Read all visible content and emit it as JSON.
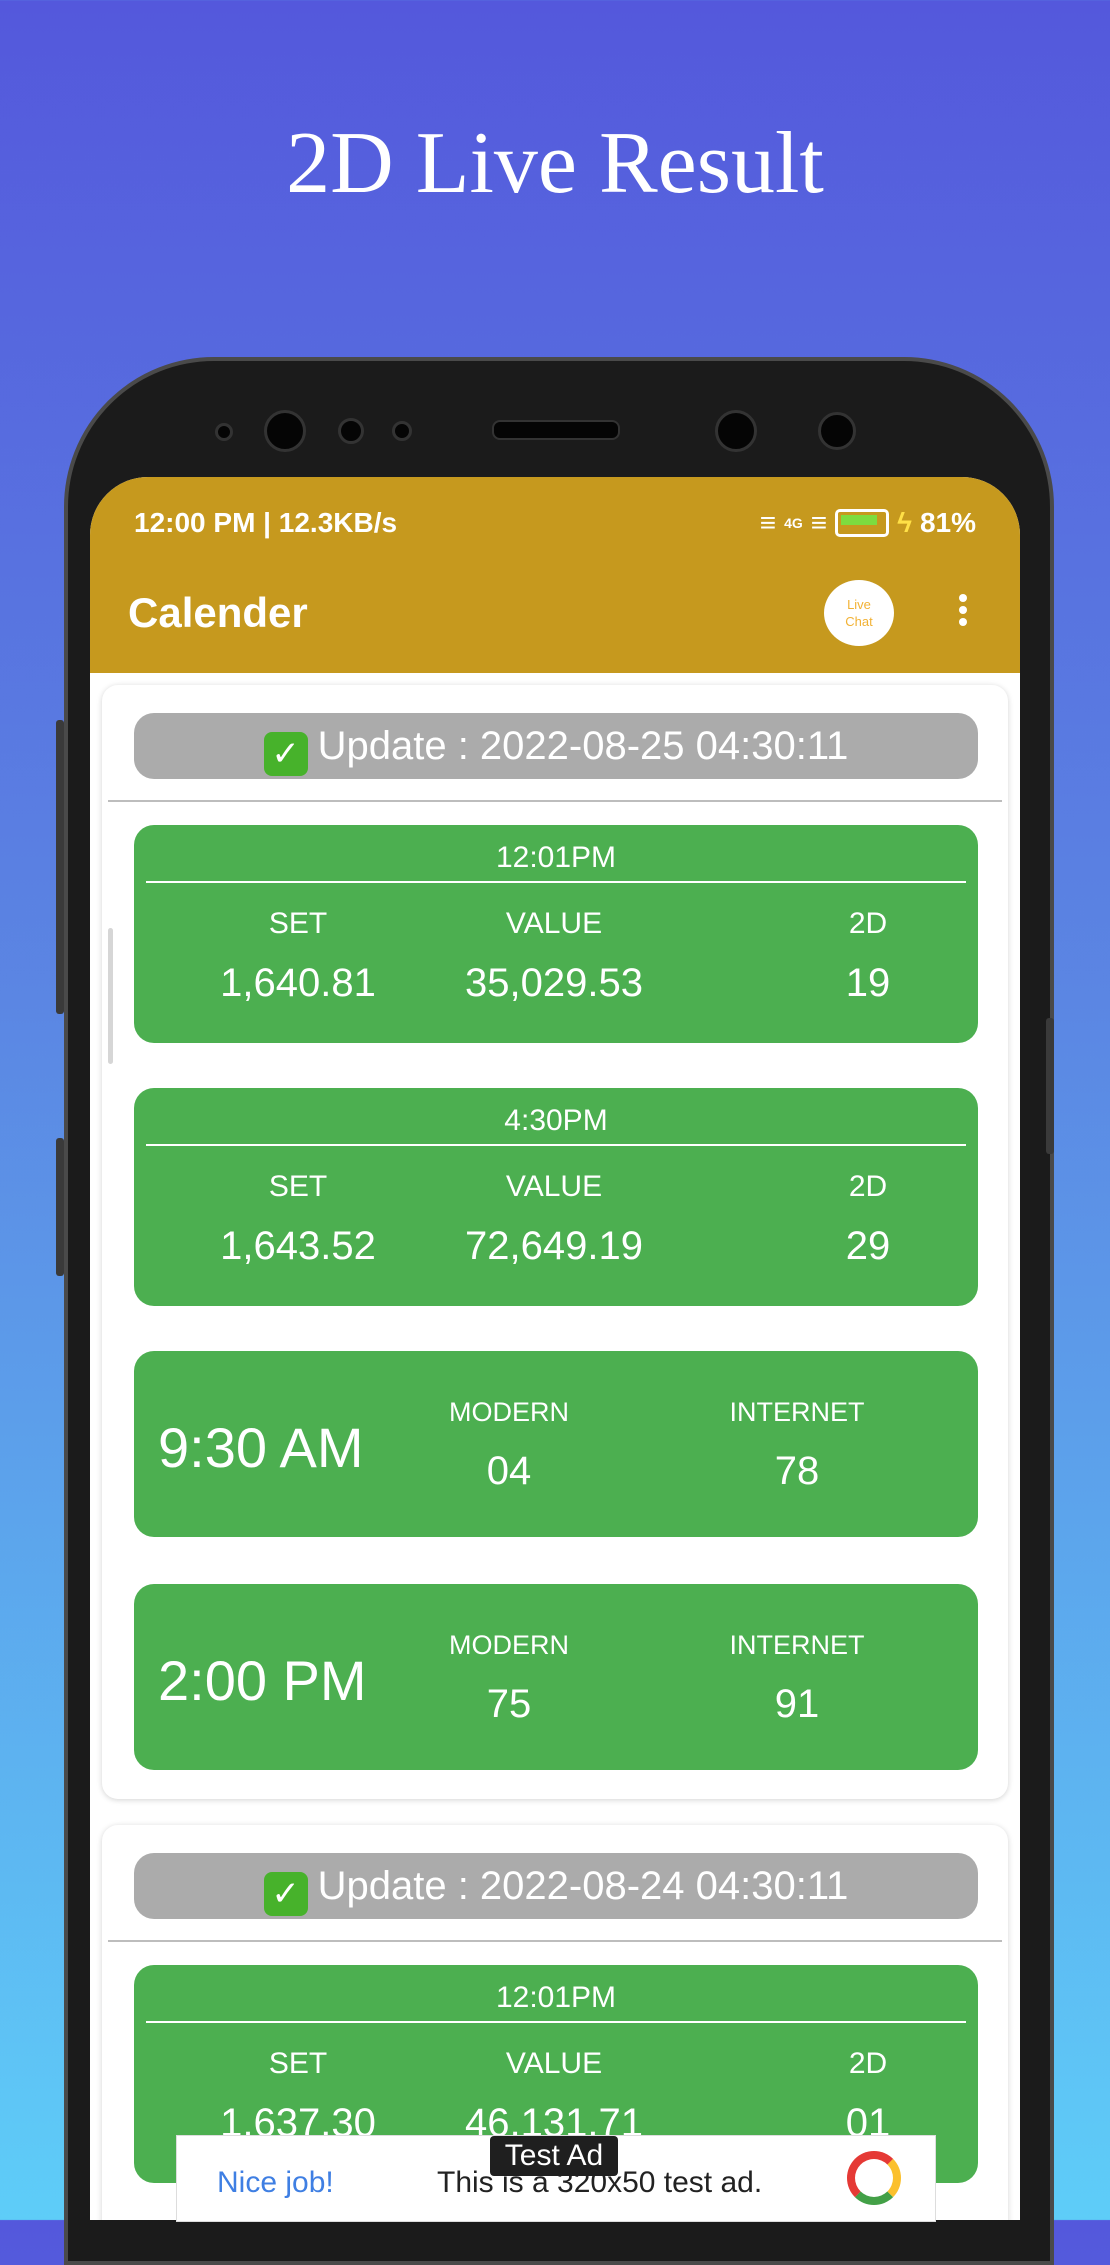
{
  "promo": {
    "title": "2D Live Result"
  },
  "status_bar": {
    "time_speed": "12:00 PM | 12.3KB/s",
    "network": "4G",
    "battery": "81%"
  },
  "app_bar": {
    "title": "Calender",
    "live_chat": [
      "Live",
      "Chat"
    ],
    "more_icon": "more-vertical-icon"
  },
  "days": [
    {
      "update": "Update : 2022-08-25 04:30:11",
      "results": [
        {
          "time": "12:01PM",
          "labels": [
            "SET",
            "VALUE",
            "2D"
          ],
          "values": [
            "1,640.81",
            "35,029.53",
            "19"
          ]
        },
        {
          "time": "4:30PM",
          "labels": [
            "SET",
            "VALUE",
            "2D"
          ],
          "values": [
            "1,643.52",
            "72,649.19",
            "29"
          ]
        }
      ],
      "modern_internet": [
        {
          "time": "9:30 AM",
          "labels": [
            "MODERN",
            "INTERNET"
          ],
          "values": [
            "04",
            "78"
          ]
        },
        {
          "time": "2:00 PM",
          "labels": [
            "MODERN",
            "INTERNET"
          ],
          "values": [
            "75",
            "91"
          ]
        }
      ]
    },
    {
      "update": "Update : 2022-08-24 04:30:11",
      "results": [
        {
          "time": "12:01PM",
          "labels": [
            "SET",
            "VALUE",
            "2D"
          ],
          "values": [
            "1,637.30",
            "46,131.71",
            "01"
          ]
        }
      ]
    }
  ],
  "ad": {
    "tag": "Test Ad",
    "left": "Nice job!",
    "text": "This is a 320x50 test ad."
  }
}
